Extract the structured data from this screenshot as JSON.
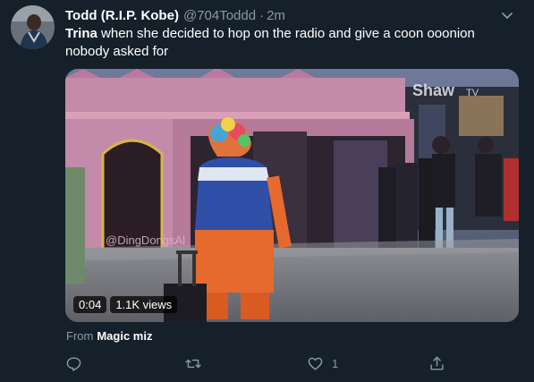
{
  "tweet": {
    "display_name": "Todd (R.I.P. Kobe)",
    "handle": "@704Toddd",
    "separator": "·",
    "time": "2m",
    "text_highlight": "Trina",
    "text_rest": " when she decided to hop on the radio and give a coon ooonion nobody asked for",
    "avatar_icon": "profile-photo",
    "caret_icon": "chevron-down-icon"
  },
  "media": {
    "duration": "0:04",
    "views": "1.1K views",
    "watermark": "Shaw",
    "watermark_tv": "TV",
    "overlay_handle": "@DingDongsAl"
  },
  "attribution": {
    "prefix": "From",
    "source": "Magic miz"
  },
  "actions": {
    "reply_icon": "reply-icon",
    "retweet_icon": "retweet-icon",
    "like_icon": "heart-icon",
    "like_count": "1",
    "share_icon": "share-icon"
  },
  "colors": {
    "background": "#15202b",
    "secondary_text": "#8899a6",
    "primary_text": "#ffffff"
  }
}
